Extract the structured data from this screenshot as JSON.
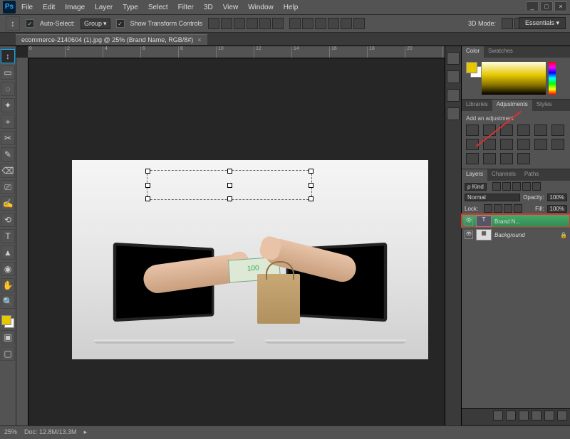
{
  "app": {
    "name": "Ps"
  },
  "menu": [
    "File",
    "Edit",
    "Image",
    "Layer",
    "Type",
    "Select",
    "Filter",
    "3D",
    "View",
    "Window",
    "Help"
  ],
  "window_controls": {
    "min": "_",
    "max": "□",
    "close": "×"
  },
  "options": {
    "auto_select": "Auto-Select:",
    "auto_select_mode": "Group",
    "show_transform": "Show Transform Controls",
    "workspace": "Essentials"
  },
  "document": {
    "tab": "ecommerce-2140604 (1).jpg @ 25% (Brand Name, RGB/8#)",
    "close": "×"
  },
  "status": {
    "zoom": "25%",
    "doc": "Doc: 12.8M/13.3M"
  },
  "tools": [
    "↕",
    "▭",
    "◌",
    "✦",
    "⌖",
    "✂",
    "✎",
    "⌫",
    "⎚",
    "✍",
    "⟲",
    "T",
    "▲",
    "◉",
    "✋",
    "🔍"
  ],
  "panel_color": {
    "tabs": [
      "Color",
      "Swatches"
    ]
  },
  "panel_adjust": {
    "tabs": [
      "Libraries",
      "Adjustments",
      "Styles"
    ],
    "title": "Add an adjustment"
  },
  "panel_layers": {
    "tabs": [
      "Layers",
      "Channels",
      "Paths"
    ],
    "kind": "ρ Kind",
    "blend": "Normal",
    "opacity_label": "Opacity:",
    "opacity": "100%",
    "lock_label": "Lock:",
    "fill_label": "Fill:",
    "fill": "100%",
    "layers": [
      {
        "name": "Brand N...",
        "type": "T"
      },
      {
        "name": "Background",
        "type": "img"
      }
    ]
  }
}
